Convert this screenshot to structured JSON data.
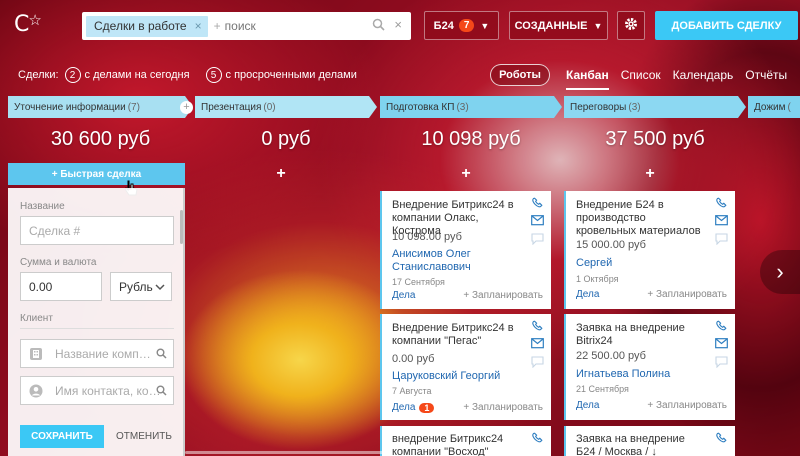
{
  "logo": {
    "text": "С",
    "star": "☆"
  },
  "search": {
    "filter_chip": "Сделки в работе",
    "chip_close": "×",
    "add": "+",
    "placeholder": "поиск",
    "clear": "×"
  },
  "header": {
    "b24_label": "Б24",
    "b24_count": "7",
    "created_label": "СОЗДАННЫЕ",
    "add_deal_label": "ДОБАВИТЬ СДЕЛКУ"
  },
  "stats": {
    "prefix": "Сделки:",
    "today_count": "2",
    "today_label": "с делами на сегодня",
    "overdue_count": "5",
    "overdue_label": "с просроченными делами"
  },
  "robots_label": "Роботы",
  "view_tabs": [
    {
      "label": "Канбан",
      "active": true
    },
    {
      "label": "Список"
    },
    {
      "label": "Календарь"
    },
    {
      "label": "Отчёты"
    }
  ],
  "columns": [
    {
      "name": "Уточнение информации",
      "count": "(7)",
      "sum": "30 600 руб",
      "color": "#a8e0f2"
    },
    {
      "name": "Презентация",
      "count": "(0)",
      "sum": "0 руб",
      "color": "#b1e5f5"
    },
    {
      "name": "Подготовка КП",
      "count": "(3)",
      "sum": "10 098 руб",
      "color": "#7fd3ef"
    },
    {
      "name": "Переговоры",
      "count": "(3)",
      "sum": "37 500 руб",
      "color": "#8cd8f2"
    },
    {
      "name": "Дожим",
      "count": "(",
      "sum": "",
      "color": "#7fd3ef"
    }
  ],
  "quick_deal_label": "+ Быстрая сделка",
  "add_plus": "+",
  "quick_form": {
    "name_label": "Название",
    "name_placeholder": "Сделка #",
    "sum_label": "Сумма и валюта",
    "sum_value": "0.00",
    "currency": "Рубль",
    "client_label": "Клиент",
    "company_placeholder": "Название комп…",
    "contact_placeholder": "Имя контакта, ко…",
    "save_label": "СОХРАНИТЬ",
    "cancel_label": "ОТМЕНИТЬ"
  },
  "cards": [
    {
      "title": "Внедрение Битрикс24 в компании Олакс, Кострома",
      "price": "10 098.00 руб",
      "contact": "Анисимов Олег Станиславович",
      "date": "17 Сентября",
      "deals": "Дела",
      "plan": "+ Запланировать"
    },
    {
      "title": "Внедрение Битрикс24 в компании \"Пегас\"",
      "price": "0.00 руб",
      "contact": "Царуковский Георгий",
      "date": "7 Августа",
      "deals": "Дела",
      "deals_count": "1",
      "plan": "+ Запланировать"
    },
    {
      "title": "внедрение Битрикс24",
      "extra": "компании \"Восход\""
    },
    {
      "title": "Внедрение Б24 в производство кровельных материалов",
      "price": "15 000.00 руб",
      "contact": "Сергей",
      "date": "1 Октября",
      "deals": "Дела",
      "plan": "+ Запланировать"
    },
    {
      "title": "Заявка на внедрение Bitrix24",
      "price": "22 500.00 руб",
      "contact": "Игнатьева Полина",
      "date": "21 Сентября",
      "deals": "Дела",
      "plan": "+ Запланировать"
    },
    {
      "title": "Заявка на внедрение Б24 / Москва / ↓"
    }
  ],
  "next_arrow": "›"
}
